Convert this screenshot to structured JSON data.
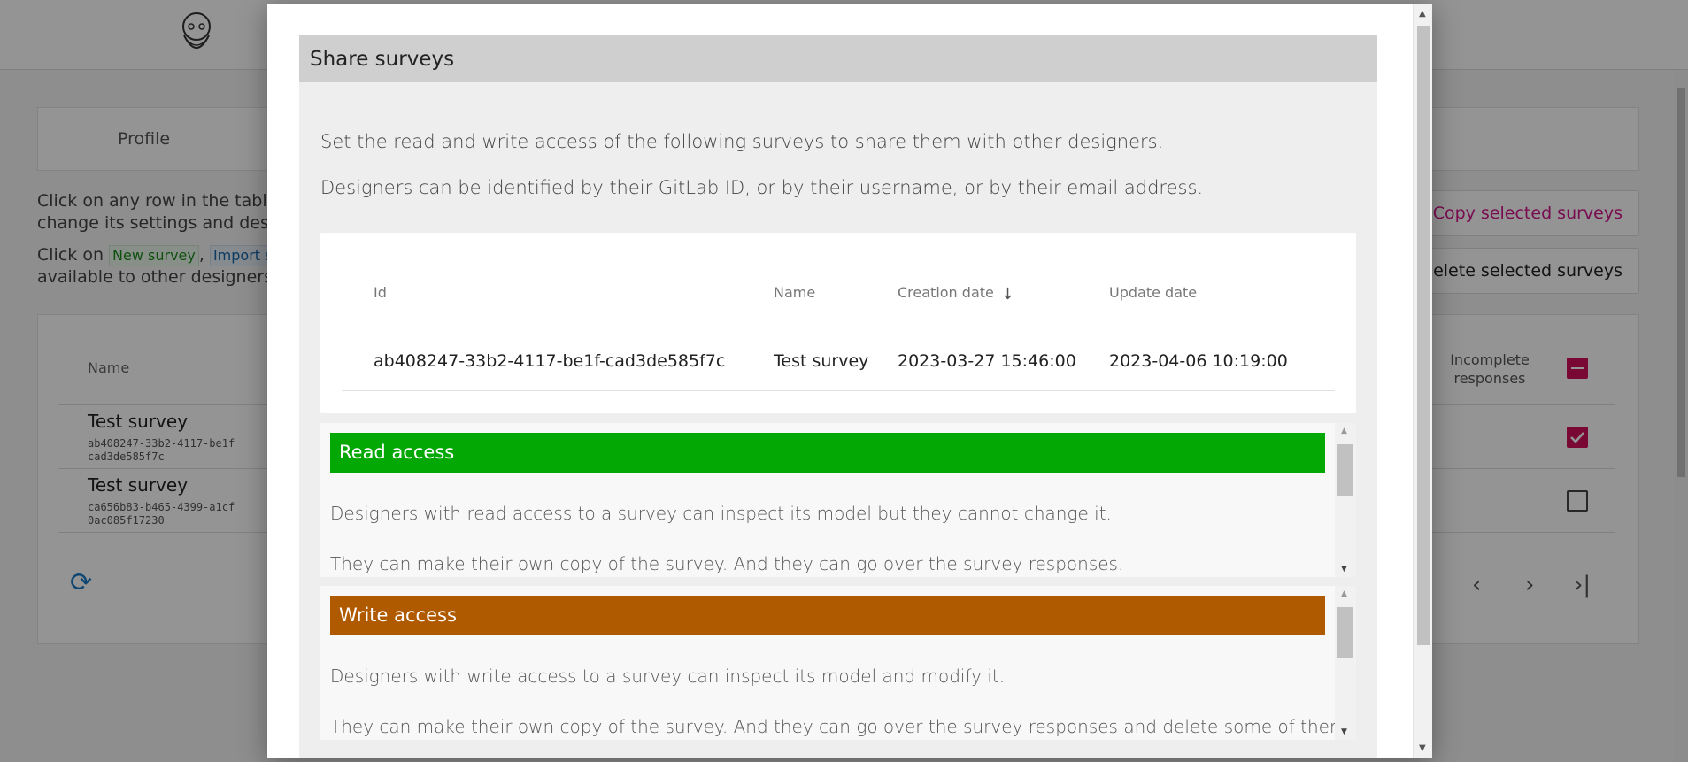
{
  "background": {
    "tabs": [
      {
        "label": "Profile"
      }
    ],
    "intro_line1": "Click on any row in the table",
    "intro_line2": "change its settings and des",
    "intro_click_on": "Click on",
    "new_survey_chip": "New survey",
    "comma": ",",
    "import_chip": "Import s",
    "intro_line4": "available to other designers",
    "copy_button": "Copy selected surveys",
    "delete_button": "Delete selected surveys",
    "table": {
      "name_header": "Name",
      "incomplete_header_1": "Incomplete",
      "incomplete_header_2": "responses",
      "rows": [
        {
          "name": "Test survey",
          "id_line1": "ab408247-33b2-4117-be1f",
          "id_line2": "cad3de585f7c",
          "checked": true
        },
        {
          "name": "Test survey",
          "id_line1": "ca656b83-b465-4399-a1cf",
          "id_line2": "0ac085f17230",
          "checked": false
        }
      ]
    },
    "pager_prev": "‹",
    "pager_next": "›",
    "pager_last": "›|"
  },
  "dialog": {
    "title": "Share surveys",
    "description_1": "Set the read and write access of the following surveys to share them with other designers.",
    "description_2": "Designers can be identified by their GitLab ID, or by their username, or by their email address.",
    "table": {
      "headers": {
        "id": "Id",
        "name": "Name",
        "creation_date": "Creation date",
        "update_date": "Update date"
      },
      "sort_indicator": "↓",
      "rows": [
        {
          "id": "ab408247-33b2-4117-be1f-cad3de585f7c",
          "name": "Test survey",
          "creation_date": "2023-03-27 15:46:00",
          "update_date": "2023-04-06 10:19:00"
        }
      ]
    },
    "read_access": {
      "title": "Read access",
      "color": "#04a804",
      "text_1": "Designers with read access to a survey can inspect its model but they cannot change it.",
      "text_2": "They can make their own copy of the survey. And they can go over the survey responses."
    },
    "write_access": {
      "title": "Write access",
      "color": "#b05a00",
      "text_1": "Designers with write access to a survey can inspect its model and modify it.",
      "text_2": "They can make their own copy of the survey. And they can go over the survey responses and delete some of them."
    }
  },
  "colors": {
    "accent": "#d0105a",
    "copy_text": "#d0168a",
    "refresh": "#1b7bc4"
  }
}
